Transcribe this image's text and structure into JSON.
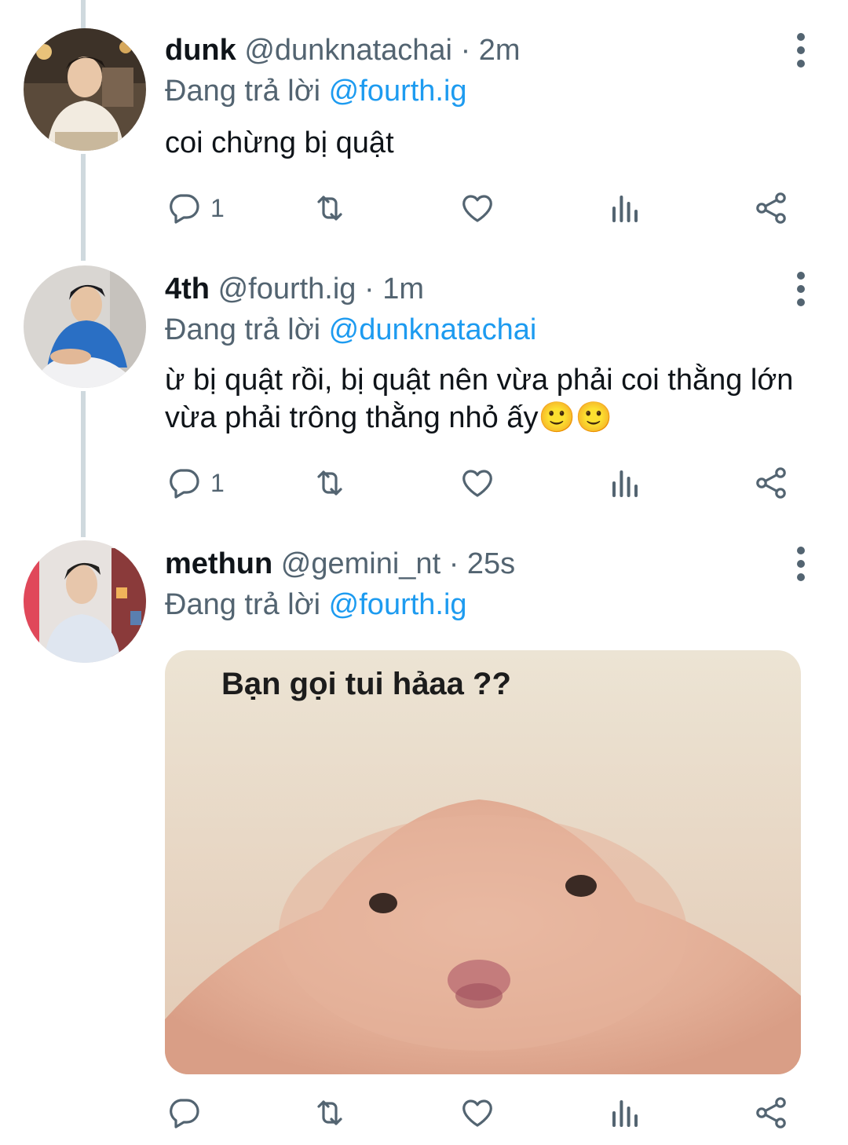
{
  "tweets": [
    {
      "name": "dunk",
      "handle": "@dunknatachai",
      "time": "· 2m",
      "reply_prefix": "Đang trả lời",
      "reply_to": "@fourth.ig",
      "text": "coi chừng bị quật",
      "reply_count": "1"
    },
    {
      "name": "4th",
      "handle": "@fourth.ig",
      "time": "· 1m",
      "reply_prefix": "Đang trả lời",
      "reply_to": "@dunknatachai",
      "text": "ừ bị quật rồi, bị quật nên vừa phải coi thằng lớn vừa phải trông thằng nhỏ ấy🙂🙂",
      "reply_count": "1"
    },
    {
      "name": "methun",
      "handle": "@gemini_nt",
      "time": "· 25s",
      "reply_prefix": "Đang trả lời",
      "reply_to": "@fourth.ig",
      "media_caption": "Bạn gọi tui hảaa ??",
      "reply_count": ""
    }
  ],
  "icons": {
    "reply": "reply-icon",
    "retweet": "retweet-icon",
    "like": "heart-icon",
    "views": "views-icon",
    "share": "share-icon",
    "more": "more-vertical-icon"
  },
  "colors": {
    "link": "#1d9bf0",
    "secondary_text": "#536471",
    "thread_line": "#cfd9de"
  }
}
